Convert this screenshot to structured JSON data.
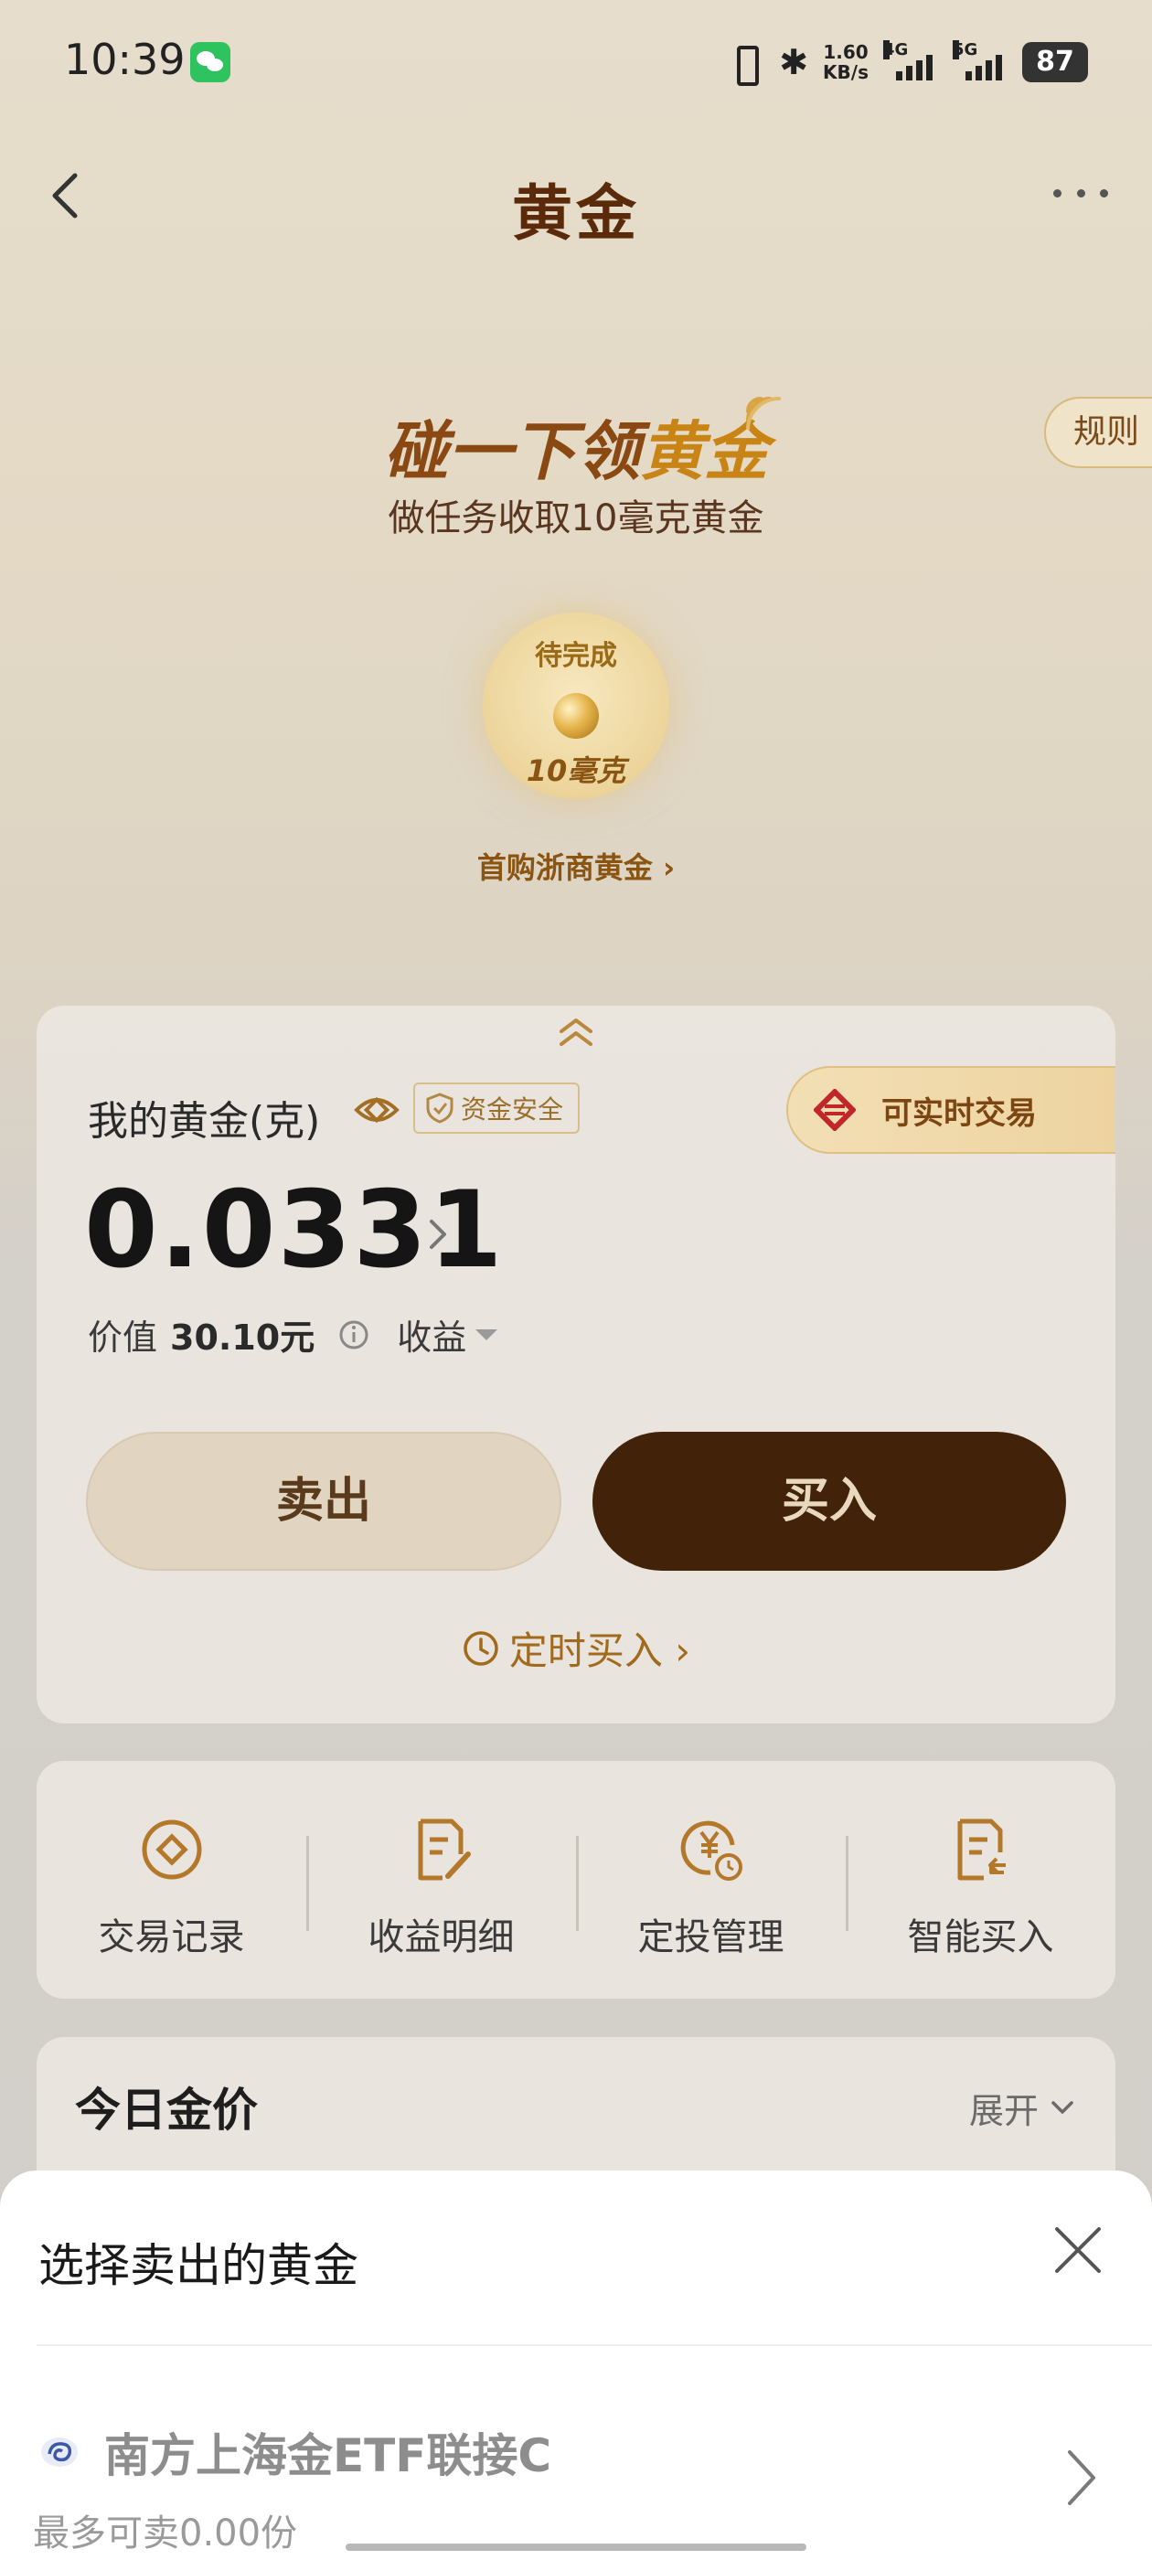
{
  "status_bar": {
    "time": "10:39",
    "net_speed_value": "1.60",
    "net_speed_unit": "KB/s",
    "signal_1": "4G",
    "signal_2": "5G",
    "battery": "87"
  },
  "nav": {
    "title": "黄金"
  },
  "hero": {
    "title_part1": "碰一下领",
    "title_part2": "黄金",
    "subtitle": "做任务收取10毫克黄金",
    "rules_label": "规则",
    "task_status": "待完成",
    "task_amount": "10毫克",
    "first_buy_link": "首购浙商黄金 ›"
  },
  "holdings": {
    "label": "我的黄金(克)",
    "safe_badge": "资金安全",
    "realtime_badge": "可实时交易",
    "amount": "0.0331",
    "value_label": "价值",
    "value_amount": "30.10元",
    "earnings_label": "收益",
    "sell_label": "卖出",
    "buy_label": "买入",
    "scheduled_buy_label": "定时买入 ›"
  },
  "quick_actions": [
    {
      "label": "交易记录",
      "icon": "coin-icon"
    },
    {
      "label": "收益明细",
      "icon": "document-edit-icon"
    },
    {
      "label": "定投管理",
      "icon": "yen-clock-icon"
    },
    {
      "label": "智能买入",
      "icon": "document-return-icon"
    }
  ],
  "today_price": {
    "title": "今日金价",
    "expand_label": "展开"
  },
  "sell_sheet": {
    "title": "选择卖出的黄金",
    "fund_name": "南方上海金ETF联接C",
    "fund_max": "最多可卖0.00份"
  },
  "colors": {
    "brand_brown": "#42230a",
    "gold_accent": "#c98416",
    "title_brown": "#5a2a0a"
  }
}
